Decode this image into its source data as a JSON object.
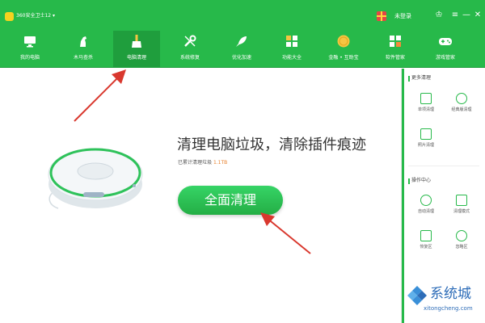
{
  "titlebar": {
    "app_title": "360安全卫士12 ▾",
    "login": "未登录",
    "shirt": "♔",
    "menu": "≡",
    "minimize": "—",
    "close": "✕"
  },
  "nav": [
    {
      "label": "我的电脑",
      "icon": "monitor-icon"
    },
    {
      "label": "木马查杀",
      "icon": "horse-icon"
    },
    {
      "label": "电脑清理",
      "icon": "broom-icon",
      "active": true
    },
    {
      "label": "系统修复",
      "icon": "wrench-icon"
    },
    {
      "label": "优化加速",
      "icon": "rocket-icon"
    },
    {
      "label": "功能大全",
      "icon": "grid-icon"
    },
    {
      "label": "金融 • 互助宝",
      "icon": "coin-icon"
    },
    {
      "label": "软件管家",
      "icon": "software-icon"
    },
    {
      "label": "游戏管家",
      "icon": "gamepad-icon"
    }
  ],
  "sidebar": {
    "section1_title": "更多清理",
    "section1_items": [
      {
        "label": "单项清理",
        "icon": "single-clean-icon"
      },
      {
        "label": "经典版清理",
        "icon": "classic-clean-icon"
      },
      {
        "label": "照片清理",
        "icon": "photo-clean-icon"
      }
    ],
    "section2_title": "操作中心",
    "section2_items": [
      {
        "label": "自动清理",
        "icon": "auto-clean-icon"
      },
      {
        "label": "清理模式",
        "icon": "clean-mode-icon"
      },
      {
        "label": "恢复区",
        "icon": "restore-icon"
      },
      {
        "label": "忽略区",
        "icon": "ignore-icon"
      }
    ]
  },
  "main": {
    "title": "清理电脑垃圾，清除插件痕迹",
    "subtitle_prefix": "已累计清理垃圾",
    "subtitle_value": "1.1TB",
    "button": "全面清理"
  },
  "watermark": {
    "text": "系统城",
    "sub": "xitongcheng.com"
  },
  "colors": {
    "brand_green": "#27b94a",
    "accent_orange": "#e8822e",
    "arrow_red": "#d9382e"
  }
}
